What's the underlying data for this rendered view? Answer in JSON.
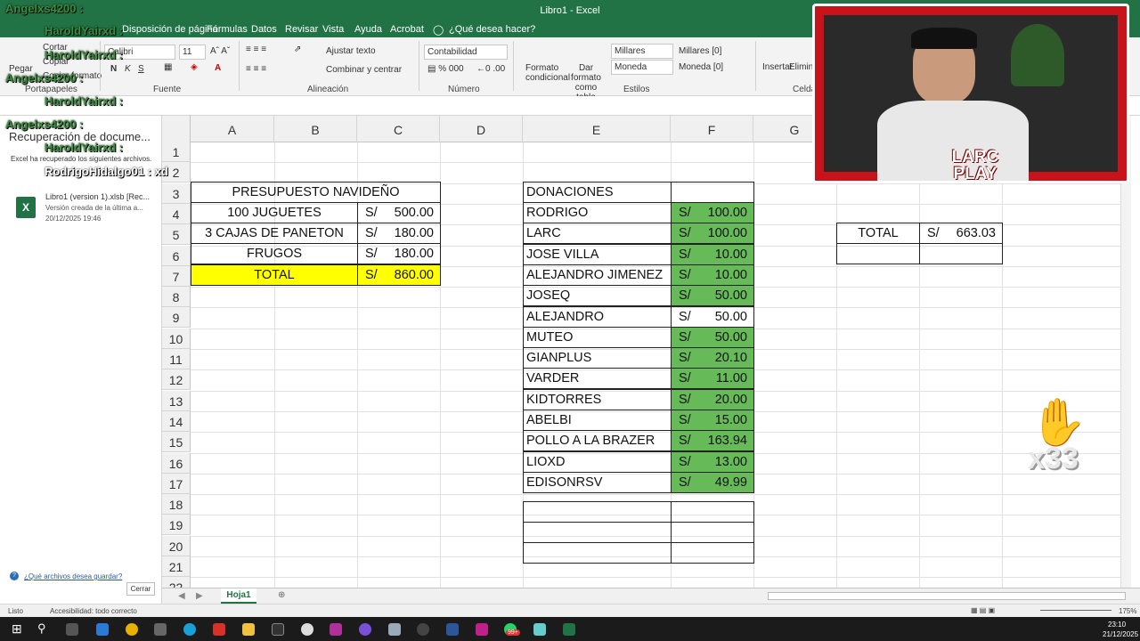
{
  "window": {
    "title": "Libro1  -  Excel"
  },
  "ribbon_tabs": [
    "Disposición de página",
    "Fórmulas",
    "Datos",
    "Revisar",
    "Vista",
    "Ayuda",
    "Acrobat",
    "¿Qué desea hacer?"
  ],
  "ribbon": {
    "clipboard": {
      "label": "Portapapeles",
      "cut": "Cortar",
      "copy": "Copiar",
      "paste": "Pegar",
      "format_painter": "Copiar formato"
    },
    "font": {
      "label": "Fuente",
      "name": "Calibri",
      "size": "11"
    },
    "alignment": {
      "label": "Alineación",
      "wrap": "Ajustar texto",
      "merge": "Combinar y centrar"
    },
    "number": {
      "label": "Número",
      "format": "Contabilidad"
    },
    "styles": {
      "label": "Estilos",
      "cond_format": "Formato condicional",
      "table_format": "Dar formato como tabla",
      "cells": [
        "Millares",
        "Millares [0]",
        "Moneda",
        "Moneda [0]"
      ]
    },
    "cells": {
      "label": "Celdas",
      "insert": "Insertar",
      "delete": "Eliminar"
    }
  },
  "recovery_panel": {
    "title": "Recuperación de docume...",
    "message": "Excel ha recuperado los siguientes archivos.",
    "file_name": "Libro1 (version 1).xlsb  [Rec...",
    "file_desc": "Versión creada de la última a...",
    "file_date": "20/12/2025 19:46",
    "help_link": "¿Qué archivos desea guardar?",
    "close_button": "Cerrar"
  },
  "chat_overlay": [
    {
      "text": "Angelxs4200 :",
      "color": "green"
    },
    {
      "text": "HaroldYairxd :",
      "color": "green"
    },
    {
      "text": "HaroldYairxd :",
      "color": "green"
    },
    {
      "text": "Angelxs4200 :",
      "color": "green"
    },
    {
      "text": "HaroldYairxd :",
      "color": "green"
    },
    {
      "text": "Angelxs4200 :",
      "color": "green"
    },
    {
      "text": "HaroldYairxd :",
      "color": "green"
    },
    {
      "text": "RodrigoHidalgo01 : xd",
      "color": "white"
    }
  ],
  "columns": [
    "A",
    "B",
    "C",
    "D",
    "E",
    "F",
    "G"
  ],
  "rows": [
    "1",
    "2",
    "3",
    "4",
    "5",
    "6",
    "7",
    "8",
    "9",
    "10",
    "11",
    "12",
    "13",
    "14",
    "15",
    "16",
    "17",
    "18",
    "19",
    "20",
    "21",
    "22"
  ],
  "budget": {
    "title": "PRESUPUESTO NAVIDEÑO",
    "items": [
      {
        "name": "100 JUGUETES",
        "currency": "S/",
        "amount": "500.00"
      },
      {
        "name": "3 CAJAS DE PANETON",
        "currency": "S/",
        "amount": "180.00"
      },
      {
        "name": "FRUGOS",
        "currency": "S/",
        "amount": "180.00"
      }
    ],
    "total": {
      "name": "TOTAL",
      "currency": "S/",
      "amount": "860.00"
    }
  },
  "donations": {
    "title": "DONACIONES",
    "items": [
      {
        "name": "RODRIGO",
        "currency": "S/",
        "amount": "100.00",
        "paid": true
      },
      {
        "name": "LARC",
        "currency": "S/",
        "amount": "100.00",
        "paid": true
      },
      {
        "name": "JOSE VILLA",
        "currency": "S/",
        "amount": "10.00",
        "paid": true
      },
      {
        "name": "ALEJANDRO JIMENEZ",
        "currency": "S/",
        "amount": "10.00",
        "paid": true
      },
      {
        "name": "JOSEQ",
        "currency": "S/",
        "amount": "50.00",
        "paid": true
      },
      {
        "name": "ALEJANDRO",
        "currency": "S/",
        "amount": "50.00",
        "paid": false
      },
      {
        "name": "MUTEO",
        "currency": "S/",
        "amount": "50.00",
        "paid": true
      },
      {
        "name": "GIANPLUS",
        "currency": "S/",
        "amount": "20.10",
        "paid": true
      },
      {
        "name": "VARDER",
        "currency": "S/",
        "amount": "11.00",
        "paid": true
      },
      {
        "name": "KIDTORRES",
        "currency": "S/",
        "amount": "20.00",
        "paid": true
      },
      {
        "name": "ABELBI",
        "currency": "S/",
        "amount": "15.00",
        "paid": true
      },
      {
        "name": "POLLO A LA BRAZER",
        "currency": "S/",
        "amount": "163.94",
        "paid": true
      },
      {
        "name": "LIOXD",
        "currency": "S/",
        "amount": "13.00",
        "paid": true
      },
      {
        "name": "EDISONRSV",
        "currency": "S/",
        "amount": "49.99",
        "paid": true
      }
    ]
  },
  "total_box": {
    "label": "TOTAL",
    "currency": "S/",
    "amount": "663.03"
  },
  "sheet_tab": "Hoja1",
  "status": {
    "ready": "Listo",
    "accessibility": "Accesibilidad: todo correcto",
    "zoom": "175%"
  },
  "taskbar": {
    "time": "23:10",
    "date": "21/12/2025",
    "badge": "99+"
  },
  "webcam": {
    "logo_line1": "LARC",
    "logo_line2": "PLAY"
  },
  "emote": {
    "count": "x33"
  },
  "colors": {
    "excel_green": "#217346",
    "paid_green": "#66bb58",
    "total_yellow": "#ffff00",
    "frame_red": "#c9131b"
  }
}
